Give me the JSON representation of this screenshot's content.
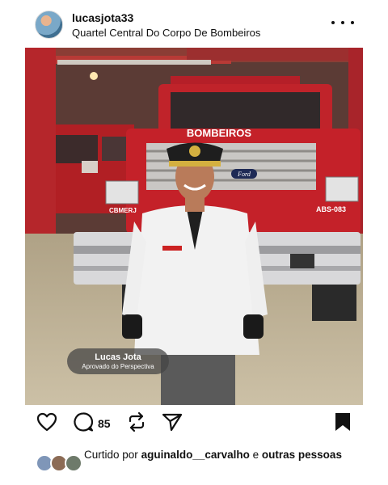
{
  "post": {
    "username": "lucasjota33",
    "location": "Quartel Central Do Corpo De Bombeiros",
    "image": {
      "overlay_name": "Lucas Jota",
      "overlay_subtitle": "Aprovado do Perspectiva",
      "truck_sign": "BOMBEIROS",
      "truck_left_plate": "CBMERJ",
      "truck_right_plate": "ABS-083",
      "truck_brand": "Ford"
    },
    "actions": {
      "like_icon": "heart-icon",
      "comment_icon": "comment-icon",
      "comment_count": "85",
      "repost_icon": "repost-icon",
      "share_icon": "send-icon",
      "save_icon": "bookmark-icon"
    },
    "likes": {
      "prefix": "Curtido por",
      "user": "aguinaldo__carvalho",
      "connector": "e",
      "suffix": "outras pessoas"
    }
  }
}
